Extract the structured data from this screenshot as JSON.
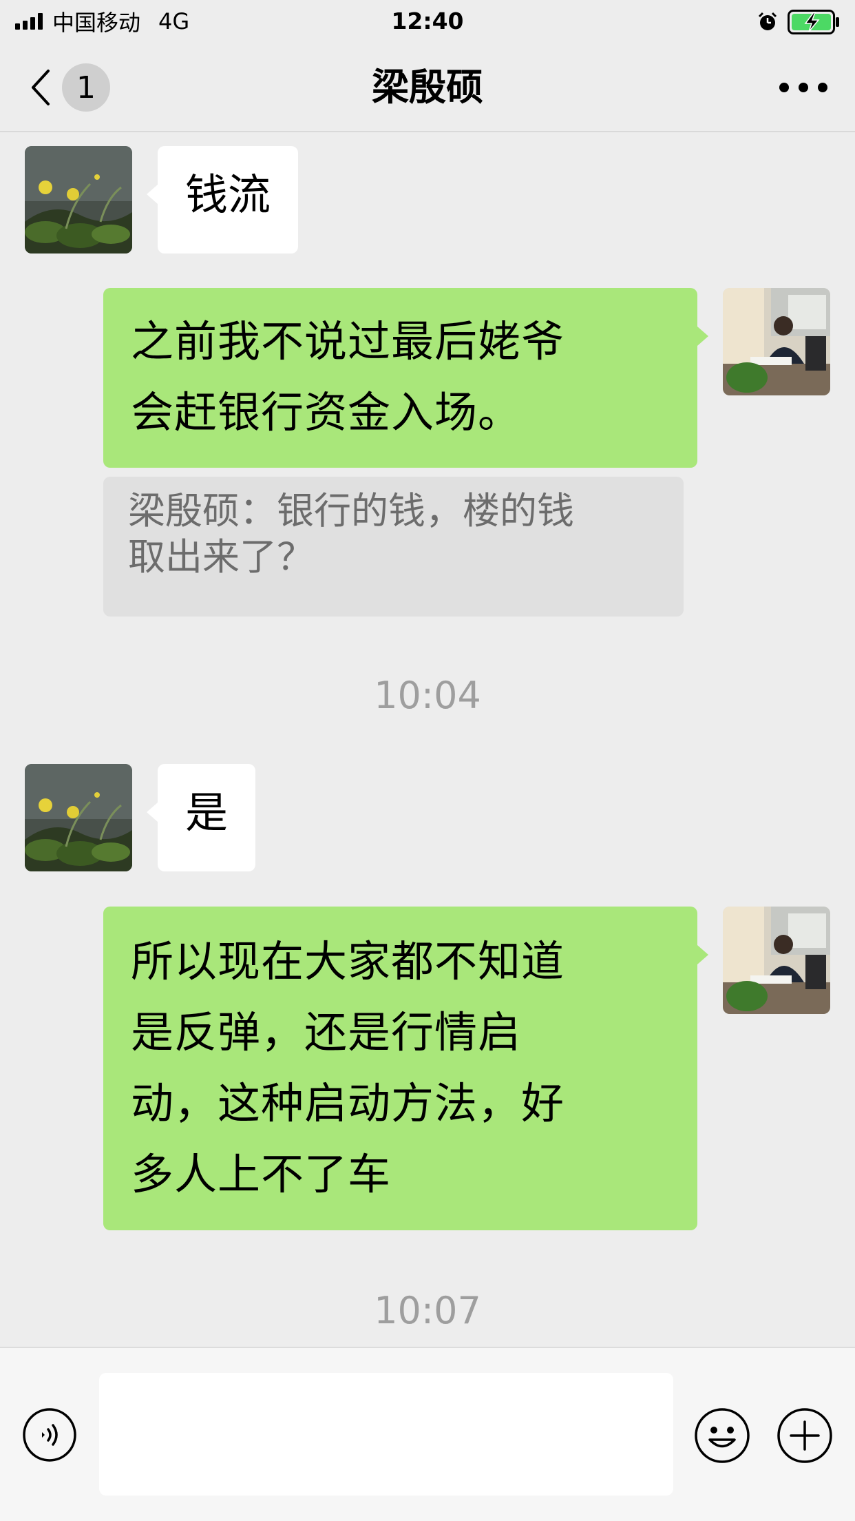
{
  "status_bar": {
    "carrier": "中国移动",
    "network": "4G",
    "time": "12:40"
  },
  "header": {
    "back_badge": "1",
    "title": "梁殷硕"
  },
  "messages": [
    {
      "side": "in",
      "text": "钱流"
    },
    {
      "side": "out",
      "lines": [
        "之前我不说过最后姥爷",
        "会赶银行资金入场。"
      ],
      "quote": [
        "梁殷硕：银行的钱，楼的钱",
        "取出来了？"
      ]
    },
    {
      "type": "time",
      "text": "10:04"
    },
    {
      "side": "in",
      "text": "是"
    },
    {
      "side": "out",
      "lines": [
        "所以现在大家都不知道",
        "是反弹，还是行情启",
        "动，这种启动方法，好",
        "多人上不了车"
      ]
    },
    {
      "type": "time",
      "text": "10:07"
    }
  ],
  "input": {
    "placeholder": ""
  },
  "colors": {
    "background": "#ededed",
    "outgoing_bubble": "#a9e77a",
    "incoming_bubble": "#ffffff",
    "quote_bg": "#e0e0e0",
    "time_text": "#9e9e9e"
  },
  "icons": {
    "back": "chevron-left-icon",
    "more": "more-dots-icon",
    "voice": "voice-icon",
    "emoji": "emoji-icon",
    "plus": "plus-icon",
    "alarm": "alarm-icon",
    "battery": "battery-charging-icon"
  }
}
